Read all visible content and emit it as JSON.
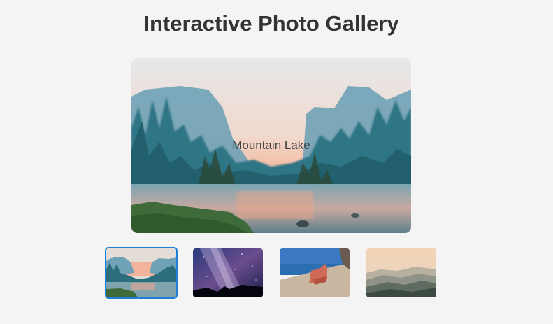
{
  "header": {
    "title": "Interactive Photo Gallery"
  },
  "viewer": {
    "caption": "Mountain Lake"
  },
  "thumbnails": [
    {
      "id": "mountain-lake",
      "active": true
    },
    {
      "id": "milky-way",
      "active": false
    },
    {
      "id": "beach-chair",
      "active": false
    },
    {
      "id": "misty-hills",
      "active": false
    }
  ],
  "colors": {
    "background": "#f4f4f4",
    "title": "#333333",
    "active_border": "#1f7fd8"
  }
}
